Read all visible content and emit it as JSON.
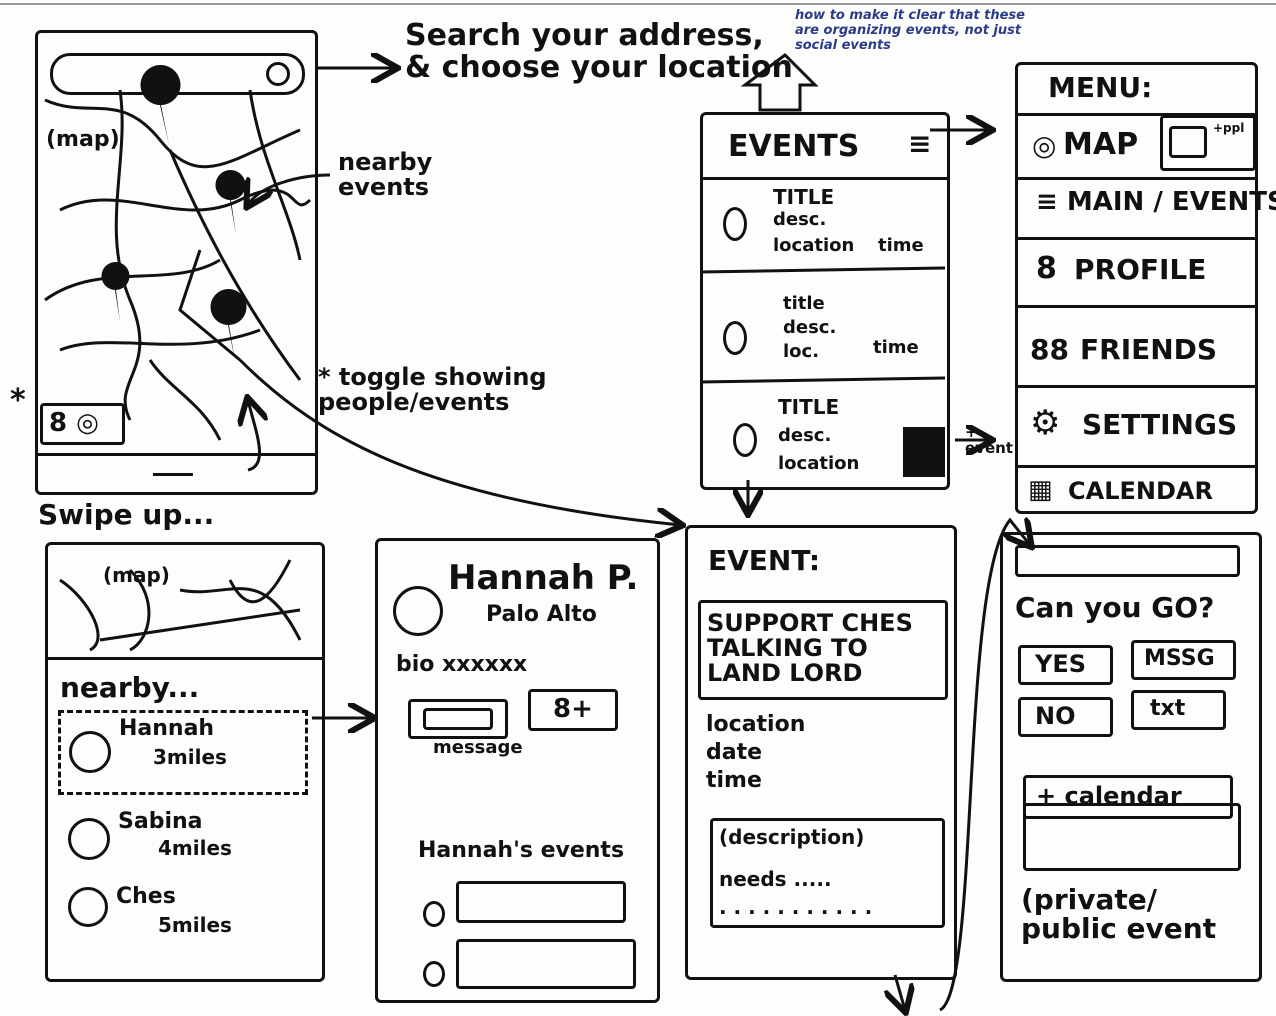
{
  "annotations": {
    "search": "Search your address,\n& choose your location",
    "nearby_events": "nearby\nevents",
    "toggle": "* toggle showing\npeople/events",
    "swipe_up": "Swipe up...",
    "pen_note": "how to make it clear that these\nare organizing events, not just\nsocial events",
    "add_event": "+\nevent",
    "asterisk": "*"
  },
  "map_screen": {
    "label": "(map)",
    "toggle_icons": "8 ◎"
  },
  "events_screen": {
    "title": "EVENTS",
    "items": [
      {
        "line1": "TITLE",
        "line2": "desc.",
        "line3": "location",
        "time": "time"
      },
      {
        "line1": "title",
        "line2": "desc.",
        "line3": "loc.",
        "time": "time"
      },
      {
        "line1": "TITLE",
        "line2": "desc.",
        "line3": "location",
        "time": ""
      }
    ]
  },
  "menu_screen": {
    "title": "MENU:",
    "items": [
      {
        "label": "MAP",
        "extra": "+ppl"
      },
      {
        "label": "≡ MAIN / EVENTS"
      },
      {
        "label": "PROFILE"
      },
      {
        "label": "FRIENDS"
      },
      {
        "label": "SETTINGS"
      },
      {
        "label": "CALENDAR"
      }
    ]
  },
  "nearby_screen": {
    "map_label": "(map)",
    "heading": "nearby...",
    "people": [
      {
        "name": "Hannah",
        "distance": "3miles"
      },
      {
        "name": "Sabina",
        "distance": "4miles"
      },
      {
        "name": "Ches",
        "distance": "5miles"
      }
    ]
  },
  "profile_screen": {
    "name": "Hannah P.",
    "city": "Palo Alto",
    "bio": "bio xxxxxx",
    "message_label": "message",
    "add_friend": "8+",
    "events_heading": "Hannah's events"
  },
  "event_screen": {
    "title": "EVENT:",
    "event_name": "SUPPORT CHES TALKING TO LAND LORD",
    "details": [
      "location",
      "date",
      "time"
    ],
    "description": "(description)",
    "needs": "needs ....."
  },
  "rsvp_screen": {
    "question": "Can you GO?",
    "yes": "YES",
    "no": "NO",
    "msg": "MSSG",
    "txt": "txt",
    "calendar": "+ calendar",
    "privacy": "(private/\npublic event"
  }
}
